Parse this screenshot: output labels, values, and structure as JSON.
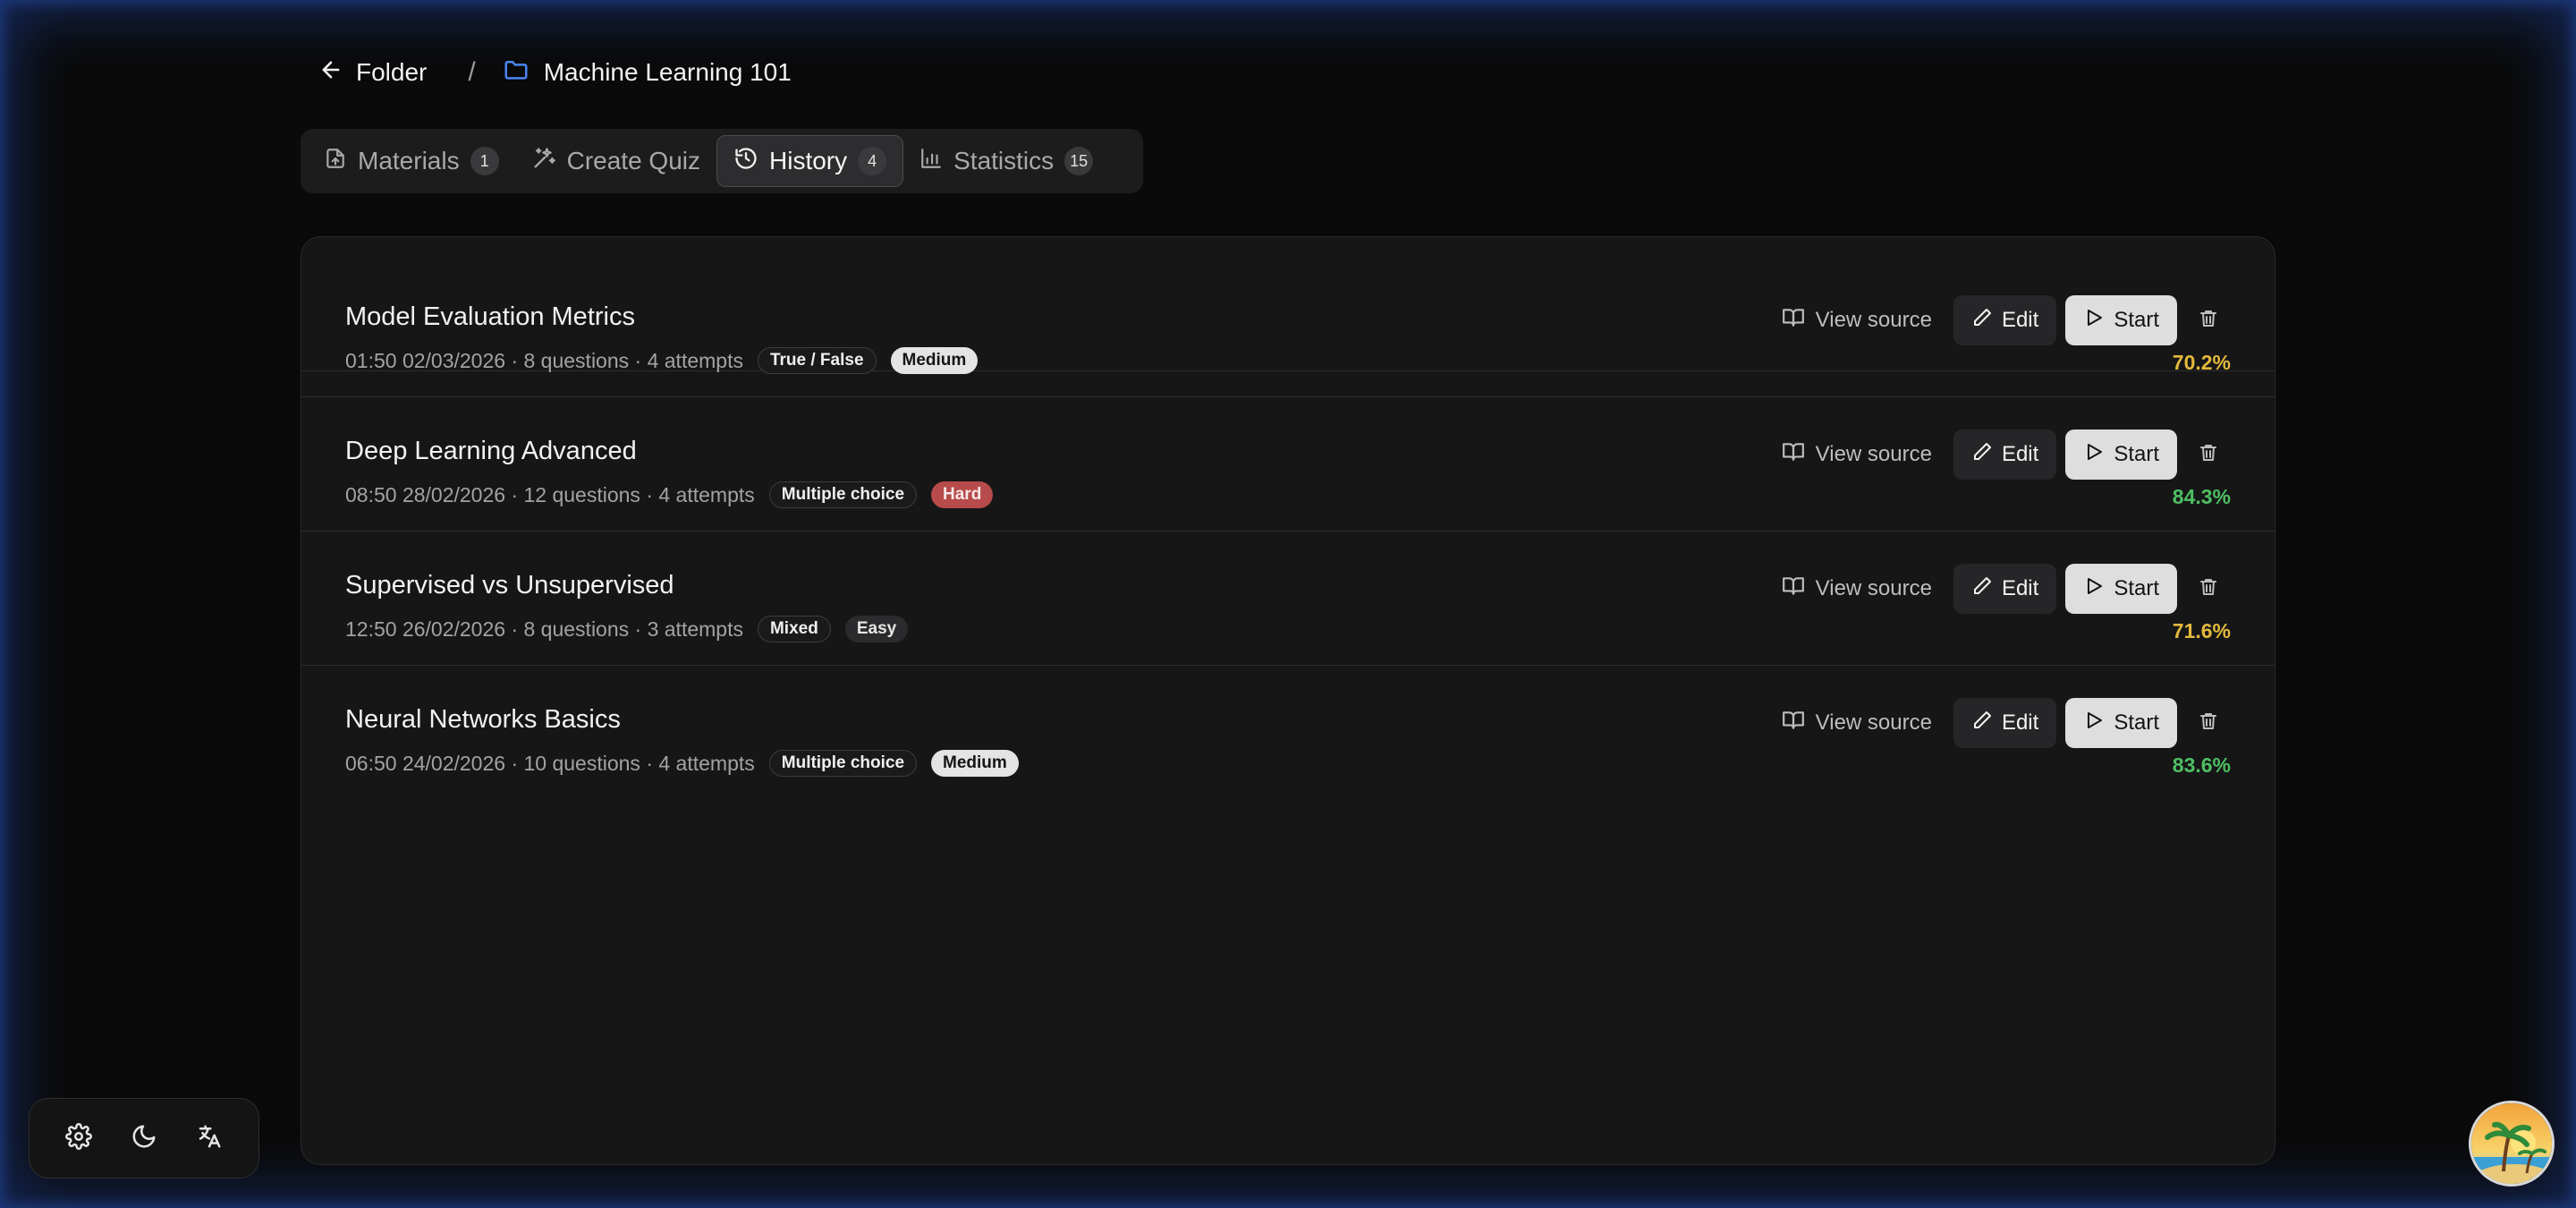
{
  "breadcrumb": {
    "back_label": "Folder",
    "separator": "/",
    "current": "Machine Learning 101",
    "folder_icon_color": "#4a86f0"
  },
  "tabs": [
    {
      "label": "Materials",
      "count": "1",
      "icon": "file-upload-icon"
    },
    {
      "label": "Create Quiz",
      "icon": "sparkles-icon"
    },
    {
      "label": "History",
      "count": "4",
      "icon": "history-icon",
      "active": true
    },
    {
      "label": "Statistics",
      "count": "15",
      "icon": "bar-chart-icon"
    }
  ],
  "actions": {
    "view_source": "View source",
    "edit": "Edit",
    "start": "Start"
  },
  "colors": {
    "score_yellow": "#e3b93d",
    "score_green": "#4fbf63",
    "hard_tag": "#b74a4a",
    "accent_blue": "#4a86f0"
  },
  "quizzes": [
    {
      "title": "Model Evaluation Metrics",
      "meta": "01:50 02/03/2026 · 8 questions · 4 attempts",
      "type": "True / False",
      "difficulty": "Medium",
      "score": "70.2%"
    },
    {
      "title": "Deep Learning Advanced",
      "meta": "08:50 28/02/2026 · 12 questions · 4 attempts",
      "type": "Multiple choice",
      "difficulty": "Hard",
      "score": "84.3%"
    },
    {
      "title": "Supervised vs Unsupervised",
      "meta": "12:50 26/02/2026 · 8 questions · 3 attempts",
      "type": "Mixed",
      "difficulty": "Easy",
      "score": "71.6%"
    },
    {
      "title": "Neural Networks Basics",
      "meta": "06:50 24/02/2026 · 10 questions · 4 attempts",
      "type": "Multiple choice",
      "difficulty": "Medium",
      "score": "83.6%"
    }
  ],
  "toolbar": [
    "settings-gear-icon",
    "moon-icon",
    "translate-icon"
  ]
}
